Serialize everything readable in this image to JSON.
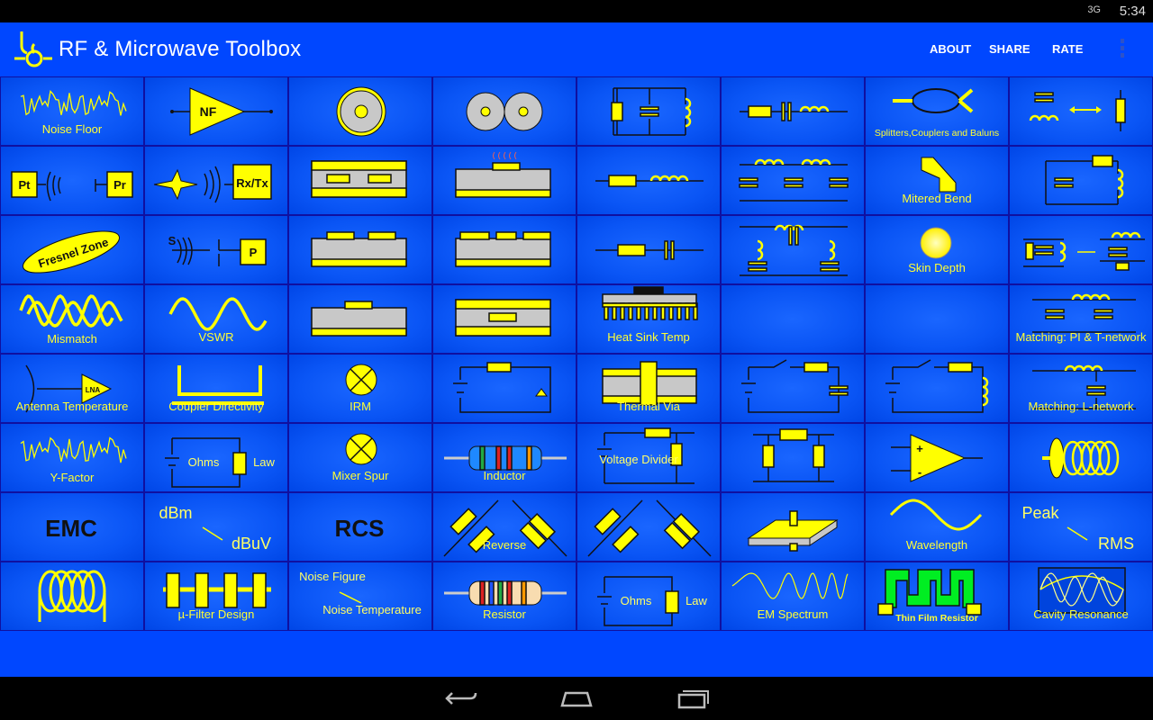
{
  "status_bar": {
    "network": "3G",
    "time": "5:34"
  },
  "app_bar": {
    "title": "RF  &  Microwave Toolbox",
    "actions": [
      "ABOUT",
      "SHARE",
      "RATE"
    ],
    "menu_icon": "overflow-menu-icon"
  },
  "colors": {
    "accent": "#ffff00",
    "background": "#0047ff",
    "grid_line": "#1010a0",
    "trace": "#111111",
    "substrate": "#c8c8c8",
    "thin_film": "#00ee00"
  },
  "tiles": [
    {
      "icon": "noise",
      "label": "Noise Floor"
    },
    {
      "icon": "amplifier",
      "texts": [
        "NF"
      ]
    },
    {
      "icon": "coax"
    },
    {
      "icon": "twin-coax"
    },
    {
      "icon": "lc-parallel"
    },
    {
      "icon": "lc-series"
    },
    {
      "icon": "splitter",
      "label": "Splitters,Couplers and Baluns"
    },
    {
      "icon": "component-convert"
    },
    {
      "icon": "friis",
      "texts": [
        "Pt",
        "Pr"
      ]
    },
    {
      "icon": "radar",
      "texts": [
        "Rx/Tx"
      ]
    },
    {
      "icon": "stripline-two"
    },
    {
      "icon": "microstrip-heat"
    },
    {
      "icon": "rl-series"
    },
    {
      "icon": "lc-ladder"
    },
    {
      "icon": "mitered-bend",
      "label": "Mitered Bend"
    },
    {
      "icon": "rlc-parallel"
    },
    {
      "icon": "fresnel",
      "texts": [
        "Fresnel Zone"
      ]
    },
    {
      "icon": "power-density",
      "texts": [
        "S",
        "P"
      ]
    },
    {
      "icon": "coupled-microstrip"
    },
    {
      "icon": "coplanar"
    },
    {
      "icon": "rc-series"
    },
    {
      "icon": "filter-pi"
    },
    {
      "icon": "skin-depth",
      "label": "Skin Depth"
    },
    {
      "icon": "series-parallel"
    },
    {
      "icon": "mismatch",
      "label": "Mismatch"
    },
    {
      "icon": "sine",
      "label": "VSWR"
    },
    {
      "icon": "microstrip"
    },
    {
      "icon": "stripline"
    },
    {
      "icon": "heat-sink",
      "label": "Heat Sink Temp"
    },
    {
      "icon": "filter-bandpass"
    },
    {
      "icon": "filter-t"
    },
    {
      "icon": "matching-pi-t",
      "label": "Matching: PI & T-network"
    },
    {
      "icon": "antenna-lna",
      "label": "Antenna Temperature",
      "texts": [
        "LNA"
      ]
    },
    {
      "icon": "coupler",
      "label": "Coupler Directivity"
    },
    {
      "icon": "mixer",
      "label": "IRM"
    },
    {
      "icon": "led-circuit"
    },
    {
      "icon": "thermal-via",
      "label": "Thermal Via"
    },
    {
      "icon": "rc-switch"
    },
    {
      "icon": "rl-switch"
    },
    {
      "icon": "matching-l",
      "label": "Matching: L-network"
    },
    {
      "icon": "noise",
      "label": "Y-Factor"
    },
    {
      "icon": "ohms-law",
      "texts": [
        "Ohms",
        "Law"
      ]
    },
    {
      "icon": "mixer",
      "label": "Mixer Spur"
    },
    {
      "icon": "inductor-color",
      "label": "Inductor"
    },
    {
      "icon": "voltage-divider",
      "texts": [
        "Voltage Divider"
      ]
    },
    {
      "icon": "attenuator"
    },
    {
      "icon": "opamp",
      "texts": [
        "+",
        "-"
      ]
    },
    {
      "icon": "air-coil"
    },
    {
      "icon": "text-big",
      "texts": [
        "EMC"
      ]
    },
    {
      "icon": "convert",
      "texts": [
        "dBm",
        "dBuV"
      ]
    },
    {
      "icon": "text-big",
      "texts": [
        "RCS"
      ]
    },
    {
      "icon": "resistors",
      "label": "Reverse"
    },
    {
      "icon": "resistors"
    },
    {
      "icon": "pcb-via"
    },
    {
      "icon": "sine-wide",
      "label": "Wavelength"
    },
    {
      "icon": "convert",
      "texts": [
        "Peak",
        "RMS"
      ]
    },
    {
      "icon": "coil"
    },
    {
      "icon": "mu-filter",
      "label": "µ-Filter Design"
    },
    {
      "icon": "convert-small",
      "texts": [
        "Noise Figure",
        "Noise Temperature"
      ]
    },
    {
      "icon": "resistor-color",
      "label": "Resistor"
    },
    {
      "icon": "ohms-law",
      "texts": [
        "Ohms",
        "Law"
      ]
    },
    {
      "icon": "em-spectrum",
      "label": "EM Spectrum"
    },
    {
      "icon": "thin-film",
      "label": "Thin Film Resistor"
    },
    {
      "icon": "cavity",
      "label": "Cavity Resonance"
    }
  ],
  "nav_bar": {
    "buttons": [
      "back-icon",
      "home-icon",
      "recents-icon"
    ]
  }
}
